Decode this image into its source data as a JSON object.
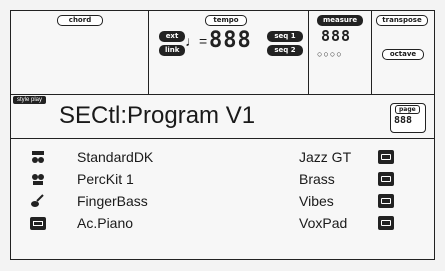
{
  "header": {
    "chord_label": "chord",
    "tempo_label": "tempo",
    "ext_label": "ext",
    "link_label": "link",
    "seq1_label": "seq 1",
    "seq2_label": "seq 2",
    "measure_label": "measure",
    "transpose_label": "transpose",
    "octave_label": "octave",
    "note_glyph": "♩=",
    "tempo_value": "888",
    "measure_value": "888"
  },
  "page": {
    "style_play": "style play",
    "title": "SECtl:Program V1",
    "page_label": "page",
    "page_value": "888"
  },
  "tracks": [
    {
      "left": "StandardDK",
      "right": "Jazz GT",
      "left_icon": "drum-kit-icon",
      "right_icon": "keyboard-icon"
    },
    {
      "left": "PercKit 1",
      "right": "Brass",
      "left_icon": "percussion-icon",
      "right_icon": "keyboard-icon"
    },
    {
      "left": "FingerBass",
      "right": "Vibes",
      "left_icon": "bass-guitar-icon",
      "right_icon": "keyboard-icon"
    },
    {
      "left": "Ac.Piano",
      "right": "VoxPad",
      "left_icon": "keyboard-icon",
      "right_icon": "keyboard-icon"
    }
  ]
}
